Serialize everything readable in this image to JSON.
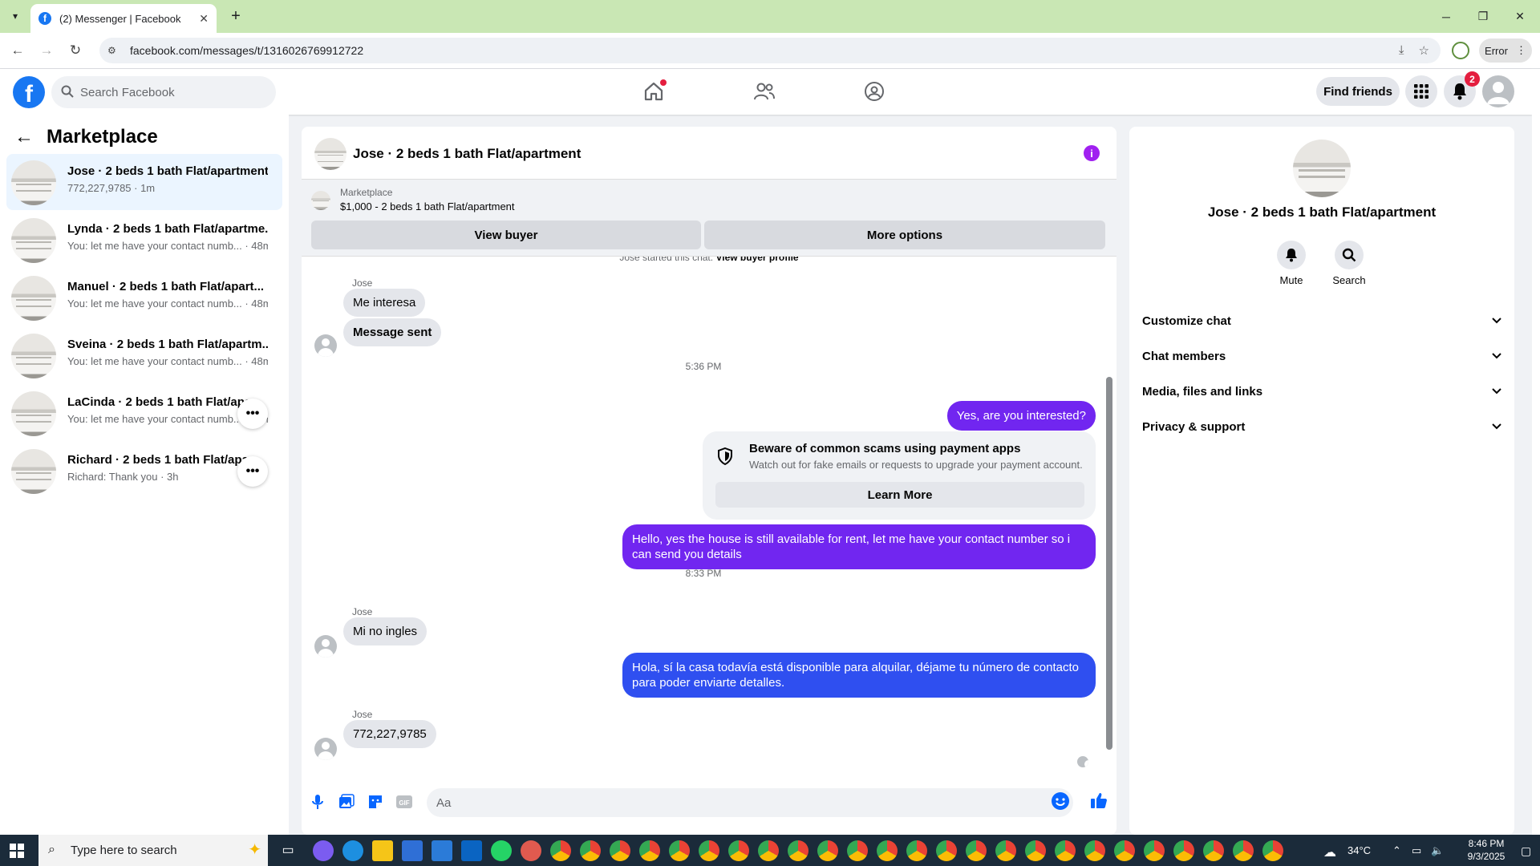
{
  "browser": {
    "tab_title": "(2) Messenger | Facebook",
    "url": "facebook.com/messages/t/1316026769912722",
    "error_label": "Error"
  },
  "fb": {
    "search_placeholder": "Search Facebook",
    "find_friends": "Find friends",
    "notification_count": "2"
  },
  "sidebar": {
    "title": "Marketplace",
    "conversations": [
      {
        "name": "Jose · 2 beds 1 bath Flat/apartment",
        "sub": "772,227,9785 · 1m"
      },
      {
        "name": "Lynda · 2 beds 1 bath Flat/apartme...",
        "sub": "You: let me have your contact numb... · 48m"
      },
      {
        "name": "Manuel · 2 beds 1 bath Flat/apart...",
        "sub": "You: let me have your contact numb... · 48m"
      },
      {
        "name": "Sveina · 2 beds 1 bath Flat/apartm...",
        "sub": "You: let me have your contact numb... · 48m"
      },
      {
        "name": "LaCinda · 2 beds 1 bath Flat/apa",
        "sub": "You: let me have your contact numb... · 48m"
      },
      {
        "name": "Richard · 2 beds 1 bath Flat/apa",
        "sub": "Richard: Thank you · 3h"
      }
    ],
    "more_icon": "•••"
  },
  "chat": {
    "title": "Jose · 2 beds 1 bath Flat/apartment",
    "listing_label": "Marketplace",
    "listing_price": "$1,000 - 2 beds 1 bath Flat/apartment",
    "view_buyer": "View buyer",
    "more_options": "More options",
    "started_text": "Jose started this chat.",
    "started_link": "View buyer profile",
    "messages": {
      "sender": "Jose",
      "m1": "Me interesa",
      "m2": "Message sent",
      "t1": "5:36 PM",
      "m3": "Yes, are you interested?",
      "scam_title": "Beware of common scams using payment apps",
      "scam_body": "Watch out for fake emails or requests to upgrade your payment account.",
      "learn_more": "Learn More",
      "m4": "Hello, yes the house is still available for rent, let me have your contact number so i can send you details",
      "t2": "8:33 PM",
      "m5": "Mi no ingles",
      "m6": "Hola, sí la casa todavía está disponible para alquilar, déjame tu número de contacto para poder enviarte detalles.",
      "m7": "772,227,9785"
    },
    "composer_placeholder": "Aa"
  },
  "right_panel": {
    "title": "Jose · 2 beds 1 bath Flat/apartment",
    "mute": "Mute",
    "search": "Search",
    "sections": [
      "Customize chat",
      "Chat members",
      "Media, files and links",
      "Privacy & support"
    ]
  },
  "taskbar": {
    "search_placeholder": "Type here to search",
    "weather": "34°C",
    "time": "8:46 PM",
    "date": "9/3/2025"
  },
  "colors": {
    "fb_blue": "#1877f2",
    "outgoing_purple": "#7126f0",
    "outgoing_blue": "#2f4ff0",
    "tabbar_green": "#c9e7b4"
  }
}
